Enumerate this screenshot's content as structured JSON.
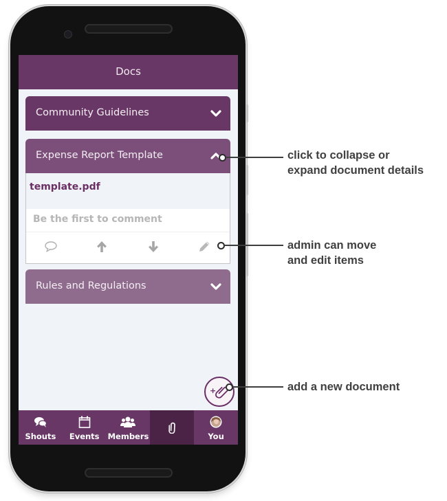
{
  "app": {
    "title": "Docs",
    "accent_color": "#693766"
  },
  "documents": [
    {
      "title": "Community Guidelines",
      "expanded": false,
      "header_color": "#693766",
      "toggle_icon": "chevron-down-icon"
    },
    {
      "title": "Expense Report Template",
      "expanded": true,
      "header_color": "#7c4f7a",
      "toggle_icon": "chevron-up-icon",
      "file_name": "template.pdf",
      "comment_placeholder": "Be the first to comment",
      "actions": [
        {
          "name": "comment",
          "icon": "speech-bubble-icon"
        },
        {
          "name": "move-up",
          "icon": "arrow-up-icon"
        },
        {
          "name": "move-down",
          "icon": "arrow-down-icon"
        },
        {
          "name": "edit",
          "icon": "pencil-icon"
        }
      ]
    },
    {
      "title": "Rules and Regulations",
      "expanded": false,
      "header_color": "#8f6c8d",
      "toggle_icon": "chevron-down-icon"
    }
  ],
  "fab": {
    "icon": "add-paperclip-icon",
    "plus": "+"
  },
  "tabbar": {
    "tabs": [
      {
        "label": "Shouts",
        "icon": "chat-bubbles-icon",
        "active": false
      },
      {
        "label": "Events",
        "icon": "calendar-icon",
        "active": false
      },
      {
        "label": "Members",
        "icon": "group-icon",
        "active": false
      },
      {
        "label": "",
        "icon": "paperclip-icon",
        "active": true
      },
      {
        "label": "You",
        "icon": "avatar",
        "active": false
      }
    ]
  },
  "callouts": [
    {
      "text_line1": "click to collapse or",
      "text_line2": "expand document details"
    },
    {
      "text_line1": "admin can move",
      "text_line2": "and edit items"
    },
    {
      "text_line1": "add a new document",
      "text_line2": ""
    }
  ]
}
